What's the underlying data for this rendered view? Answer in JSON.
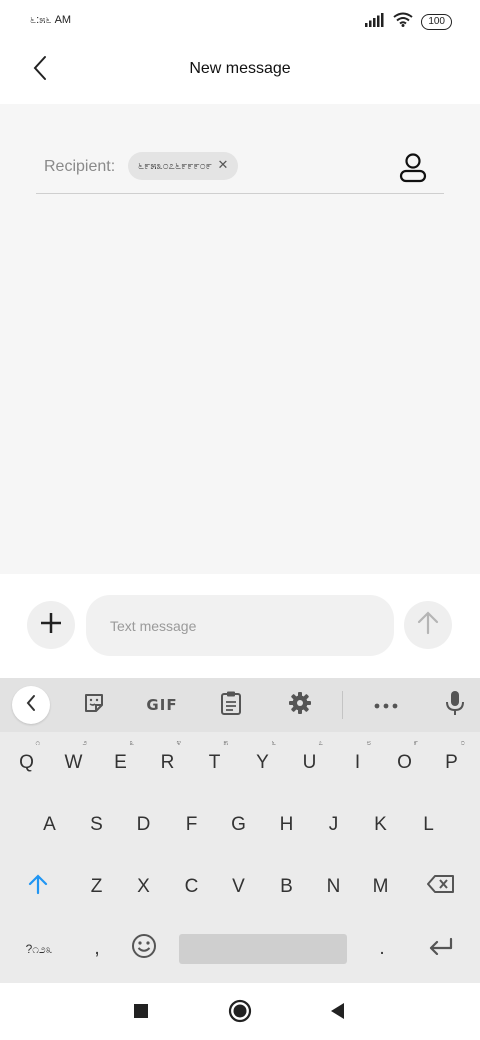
{
  "status_bar": {
    "time": "೬:೫೬ AM",
    "battery": "100"
  },
  "header": {
    "title": "New message"
  },
  "recipient": {
    "label": "Recipient:",
    "chip": "೬೯೫೩೦೭೬೯೯೯೦೯"
  },
  "composer": {
    "placeholder": "Text message"
  },
  "keyboard": {
    "toolbar": {
      "gif": "GIF"
    },
    "row1": [
      {
        "key": "Q",
        "hint": "೧"
      },
      {
        "key": "W",
        "hint": "೨"
      },
      {
        "key": "E",
        "hint": "೩"
      },
      {
        "key": "R",
        "hint": "೪"
      },
      {
        "key": "T",
        "hint": "೫"
      },
      {
        "key": "Y",
        "hint": "೬"
      },
      {
        "key": "U",
        "hint": "೭"
      },
      {
        "key": "I",
        "hint": "೮"
      },
      {
        "key": "O",
        "hint": "೯"
      },
      {
        "key": "P",
        "hint": "೦"
      }
    ],
    "row2": [
      "A",
      "S",
      "D",
      "F",
      "G",
      "H",
      "J",
      "K",
      "L"
    ],
    "row3": [
      "Z",
      "X",
      "C",
      "V",
      "B",
      "N",
      "M"
    ],
    "row4": {
      "symbols": "?೧೨೩",
      "comma": ",",
      "period": "."
    }
  },
  "colors": {
    "accent": "#2196f3",
    "content_bg": "#f6f6f6",
    "keyboard_bg": "#ebebeb"
  },
  "icons": {
    "back": "chevron-left-icon",
    "contact": "person-icon",
    "add": "plus-icon",
    "send": "arrow-up-icon",
    "collapse": "chevron-left-icon",
    "sticker": "sticker-icon",
    "clipboard": "clipboard-icon",
    "settings": "gear-icon",
    "more": "more-horizontal-icon",
    "mic": "microphone-icon",
    "shift": "shift-icon",
    "backspace": "backspace-icon",
    "emoji": "emoji-icon",
    "enter": "enter-icon",
    "nav_recents": "square-icon",
    "nav_home": "circle-icon",
    "nav_back": "triangle-back-icon"
  }
}
